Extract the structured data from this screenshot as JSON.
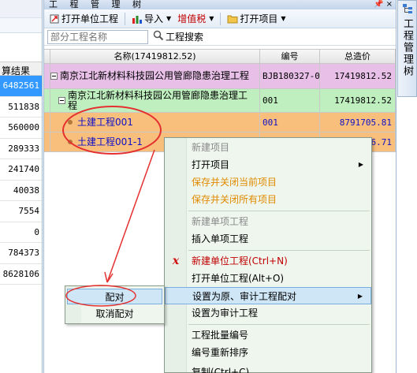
{
  "left_panel": {
    "header": "算结果",
    "values": [
      "6482561",
      "511838",
      "560000",
      "289333",
      "241740",
      "40038",
      "7554",
      "0",
      "784373",
      "8628106"
    ]
  },
  "tree_panel": {
    "title": "工 程 管 理 树",
    "pin": "📌 ×",
    "toolbar": {
      "open_unit": "打开单位工程",
      "import": "导入",
      "vat": "增值税",
      "open_project": "打开项目"
    },
    "search": {
      "placeholder": "部分工程名称",
      "button": "工程搜索"
    },
    "columns": {
      "name": "名称(17419812.52)",
      "code": "编号",
      "total": "总造价"
    },
    "rows": [
      {
        "name": "南京江北新材料科技园公用管廊隐患治理工程",
        "code": "BJB180327-0",
        "total": "17419812.52"
      },
      {
        "name": "南京江北新材料科技园公用管廊隐患治理工程",
        "code": "001",
        "total": "17419812.52"
      },
      {
        "name": "土建工程001",
        "code": "001",
        "total": "8791705.81"
      },
      {
        "name": "土建工程001-1",
        "code": "001",
        "total": "8628106.71"
      }
    ]
  },
  "side_tab": {
    "label": "工程管理树"
  },
  "context_menu": {
    "items": [
      {
        "label": "新建项目",
        "state": "disabled"
      },
      {
        "label": "打开项目",
        "state": "normal",
        "submenu": true
      },
      {
        "label": "保存并关闭当前项目",
        "state": "orange"
      },
      {
        "label": "保存并关闭所有项目",
        "state": "orange"
      },
      {
        "label": "新建单项工程",
        "state": "disabled"
      },
      {
        "label": "插入单项工程",
        "state": "normal"
      },
      {
        "label": "新建单位工程(Ctrl+N)",
        "state": "red"
      },
      {
        "label": "打开单位工程(Alt+O)",
        "state": "normal"
      },
      {
        "label": "设置为原、审计工程配对",
        "state": "highlight",
        "submenu": true
      },
      {
        "label": "设置为审计工程",
        "state": "normal"
      },
      {
        "label": "工程批量编号",
        "state": "normal"
      },
      {
        "label": "编号重新排序",
        "state": "normal"
      },
      {
        "label": "复制(Ctrl+C)",
        "state": "normal"
      }
    ]
  },
  "submenu": {
    "pair": "配对",
    "unpair": "取消配对"
  },
  "colors": {
    "row_project": "#e7bfe7",
    "row_item": "#bfefbf",
    "row_unit": "#f7be7c",
    "annotation": "#e53030"
  }
}
